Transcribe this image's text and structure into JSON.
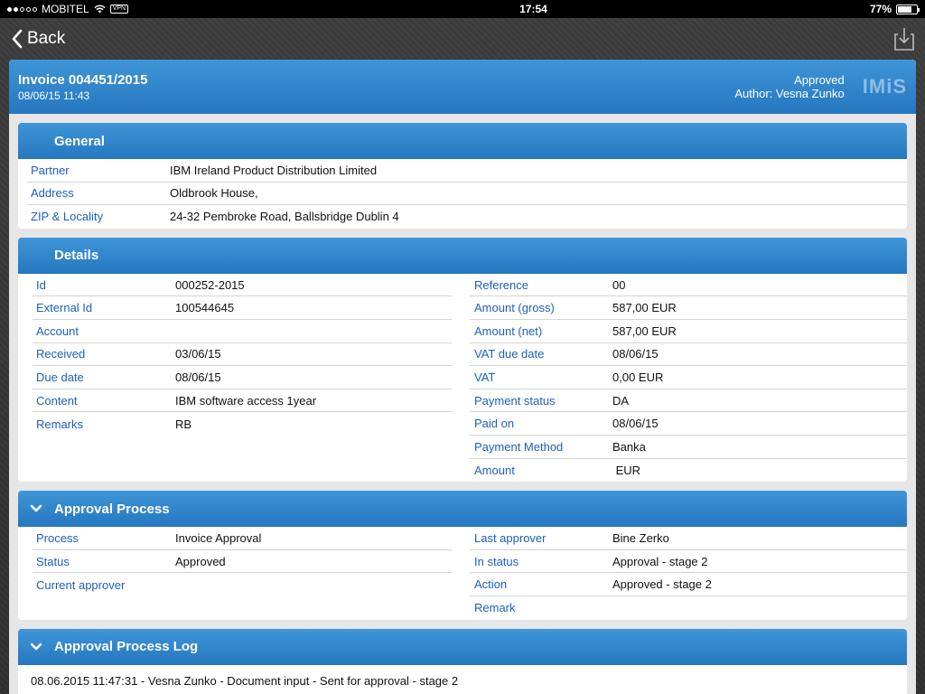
{
  "status_bar": {
    "carrier": "MOBITEL",
    "vpn": "VPN",
    "time": "17:54",
    "battery": "77%"
  },
  "nav": {
    "back_label": "Back"
  },
  "invoice": {
    "title": "Invoice 004451/2015",
    "datetime": "08/06/15 11:43",
    "status": "Approved",
    "author": "Author: Vesna Zunko",
    "logo": "IMiS"
  },
  "general": {
    "title": "General",
    "rows": [
      {
        "label": "Partner",
        "value": "IBM Ireland Product Distribution Limited"
      },
      {
        "label": "Address",
        "value": "Oldbrook House,"
      },
      {
        "label": "ZIP & Locality",
        "value": "24-32 Pembroke Road, Ballsbridge Dublin 4"
      }
    ]
  },
  "details": {
    "title": "Details",
    "left": [
      {
        "label": "Id",
        "value": "000252-2015"
      },
      {
        "label": "External Id",
        "value": "100544645"
      },
      {
        "label": "Account",
        "value": ""
      },
      {
        "label": "Received",
        "value": "03/06/15"
      },
      {
        "label": "Due date",
        "value": "08/06/15"
      },
      {
        "label": "Content",
        "value": "IBM software access 1year"
      },
      {
        "label": "Remarks",
        "value": "RB"
      }
    ],
    "right": [
      {
        "label": "Reference",
        "value": "00"
      },
      {
        "label": "Amount (gross)",
        "value": "587,00 EUR"
      },
      {
        "label": "Amount (net)",
        "value": "587,00 EUR"
      },
      {
        "label": "VAT due date",
        "value": "08/06/15"
      },
      {
        "label": "VAT",
        "value": "0,00 EUR"
      },
      {
        "label": "Payment status",
        "value": "DA"
      },
      {
        "label": "Paid on",
        "value": "08/06/15"
      },
      {
        "label": "Payment Method",
        "value": "Banka"
      },
      {
        "label": "Amount",
        "value": " EUR"
      }
    ]
  },
  "approval": {
    "title": "Approval Process",
    "left": [
      {
        "label": "Process",
        "value": "Invoice Approval"
      },
      {
        "label": "Status",
        "value": "Approved"
      },
      {
        "label": "Current approver",
        "value": ""
      }
    ],
    "right": [
      {
        "label": "Last approver",
        "value": "Bine Zerko"
      },
      {
        "label": "In status",
        "value": "Approval - stage 2"
      },
      {
        "label": "Action",
        "value": "Approved - stage 2"
      },
      {
        "label": "Remark",
        "value": ""
      }
    ]
  },
  "log": {
    "title": "Approval Process Log",
    "entries": [
      "08.06.2015 11:47:31 - Vesna Zunko - Document input - Sent for approval - stage 2"
    ]
  }
}
